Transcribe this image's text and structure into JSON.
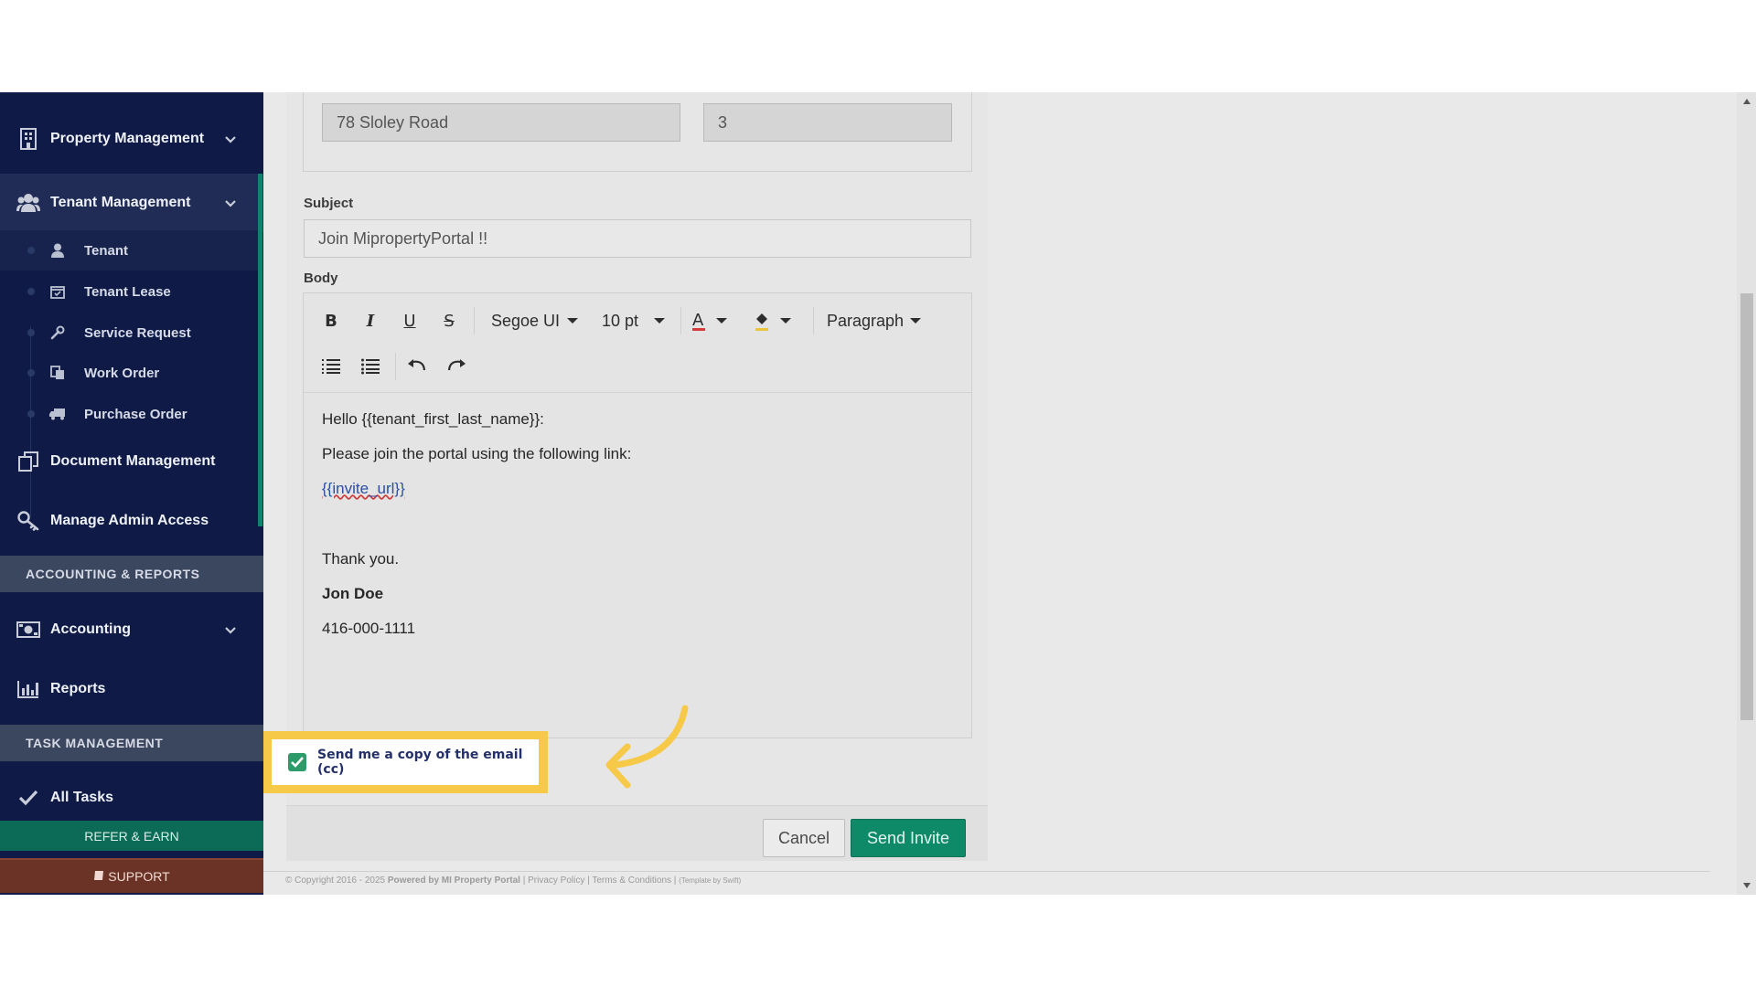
{
  "sidebar": {
    "items": [
      {
        "label": "Property Management",
        "icon": "building-icon"
      },
      {
        "label": "Tenant Management",
        "icon": "users-icon"
      },
      {
        "label": "Document Management",
        "icon": "documents-icon"
      },
      {
        "label": "Manage Admin Access",
        "icon": "key-icon"
      },
      {
        "label": "Accounting",
        "icon": "money-icon"
      },
      {
        "label": "Reports",
        "icon": "bar-chart-icon"
      },
      {
        "label": "All Tasks",
        "icon": "check-icon"
      }
    ],
    "submenu": [
      {
        "label": "Tenant",
        "icon": "user-icon"
      },
      {
        "label": "Tenant Lease",
        "icon": "calendar-icon"
      },
      {
        "label": "Service Request",
        "icon": "wrench-icon"
      },
      {
        "label": "Work Order",
        "icon": "copy-icon"
      },
      {
        "label": "Purchase Order",
        "icon": "truck-icon"
      }
    ],
    "section_accounting": "ACCOUNTING & REPORTS",
    "section_tasks": "TASK MANAGEMENT",
    "refer_label": "REFER & EARN",
    "support_label": "SUPPORT"
  },
  "form": {
    "property_value": "78  Sloley Road",
    "unit_value": "3",
    "subject_label": "Subject",
    "subject_value": "Join MipropertyPortal !!",
    "body_label": "Body"
  },
  "toolbar": {
    "font_family": "Segoe UI",
    "font_size": "10 pt",
    "block_format": "Paragraph"
  },
  "email_body": {
    "greeting": "Hello {{tenant_first_last_name}}:",
    "line1": "Please join the portal using the following link:",
    "link": "{{invite_url}}",
    "thanks": "Thank you.",
    "name": "Jon Doe",
    "phone": "416-000-1111"
  },
  "cc_checkbox": {
    "label": "Send me a copy of the email (cc)",
    "checked": true
  },
  "buttons": {
    "cancel": "Cancel",
    "send": "Send Invite"
  },
  "footer": {
    "copyright": "© Copyright 2016 - 2025",
    "powered": "Powered by MI Property Portal",
    "privacy": "Privacy Policy",
    "terms": "Terms & Conditions",
    "template": "(Template by Swift)"
  },
  "colors": {
    "sidebar_bg": "#0f1b46",
    "accent_green": "#11836d",
    "highlight_yellow": "#f7c948"
  }
}
